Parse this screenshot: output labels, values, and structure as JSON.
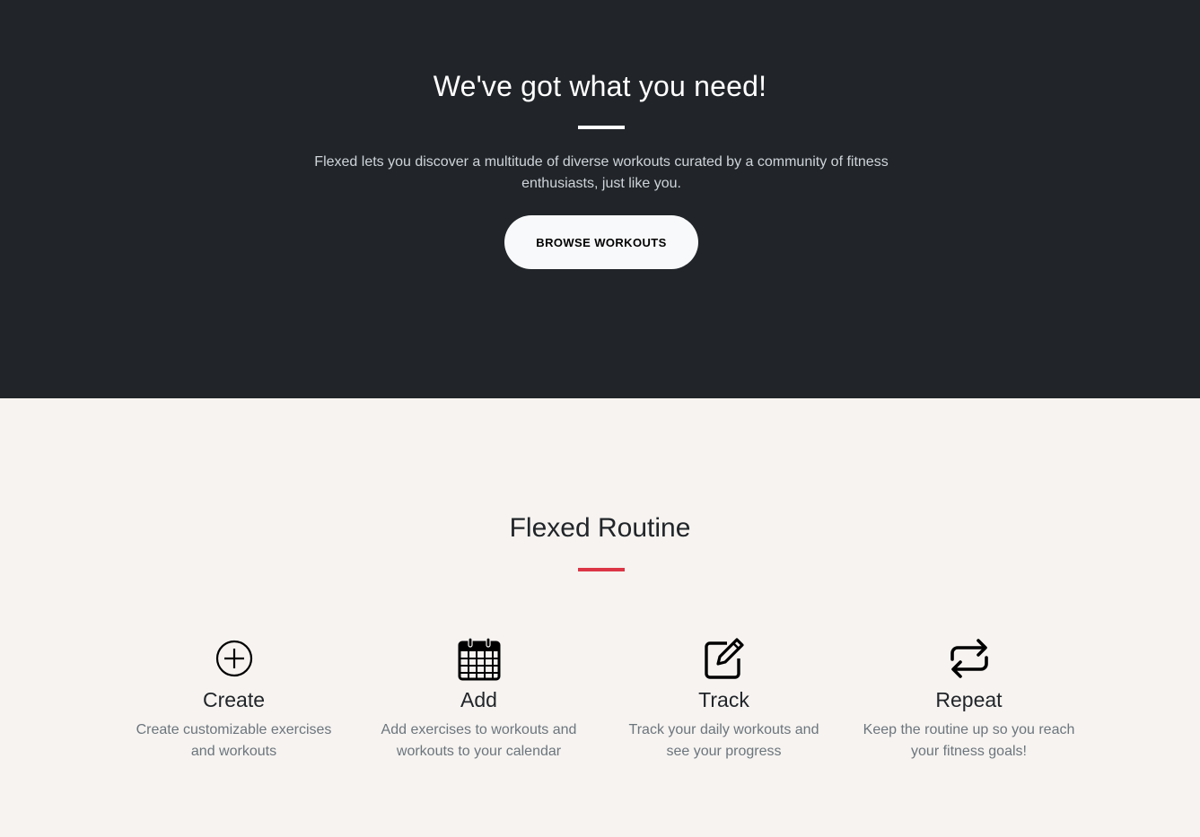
{
  "hero": {
    "title": "We've got what you need!",
    "description": "Flexed lets you discover a multitude of diverse workouts curated by a community of fitness enthusiasts, just like you.",
    "button_label": "BROWSE WORKOUTS",
    "background_color": "#212529",
    "divider_color": "#ffffff"
  },
  "routine": {
    "title": "Flexed Routine",
    "divider_color": "#dc3545",
    "features": [
      {
        "icon": "plus-circle-icon",
        "title": "Create",
        "text": "Create customizable exercises and workouts"
      },
      {
        "icon": "calendar-icon",
        "title": "Add",
        "text": "Add exercises to workouts and workouts to your calendar"
      },
      {
        "icon": "edit-icon",
        "title": "Track",
        "text": "Track your daily workouts and see your progress"
      },
      {
        "icon": "repeat-icon",
        "title": "Repeat",
        "text": "Keep the routine up so you reach your fitness goals!"
      }
    ]
  }
}
